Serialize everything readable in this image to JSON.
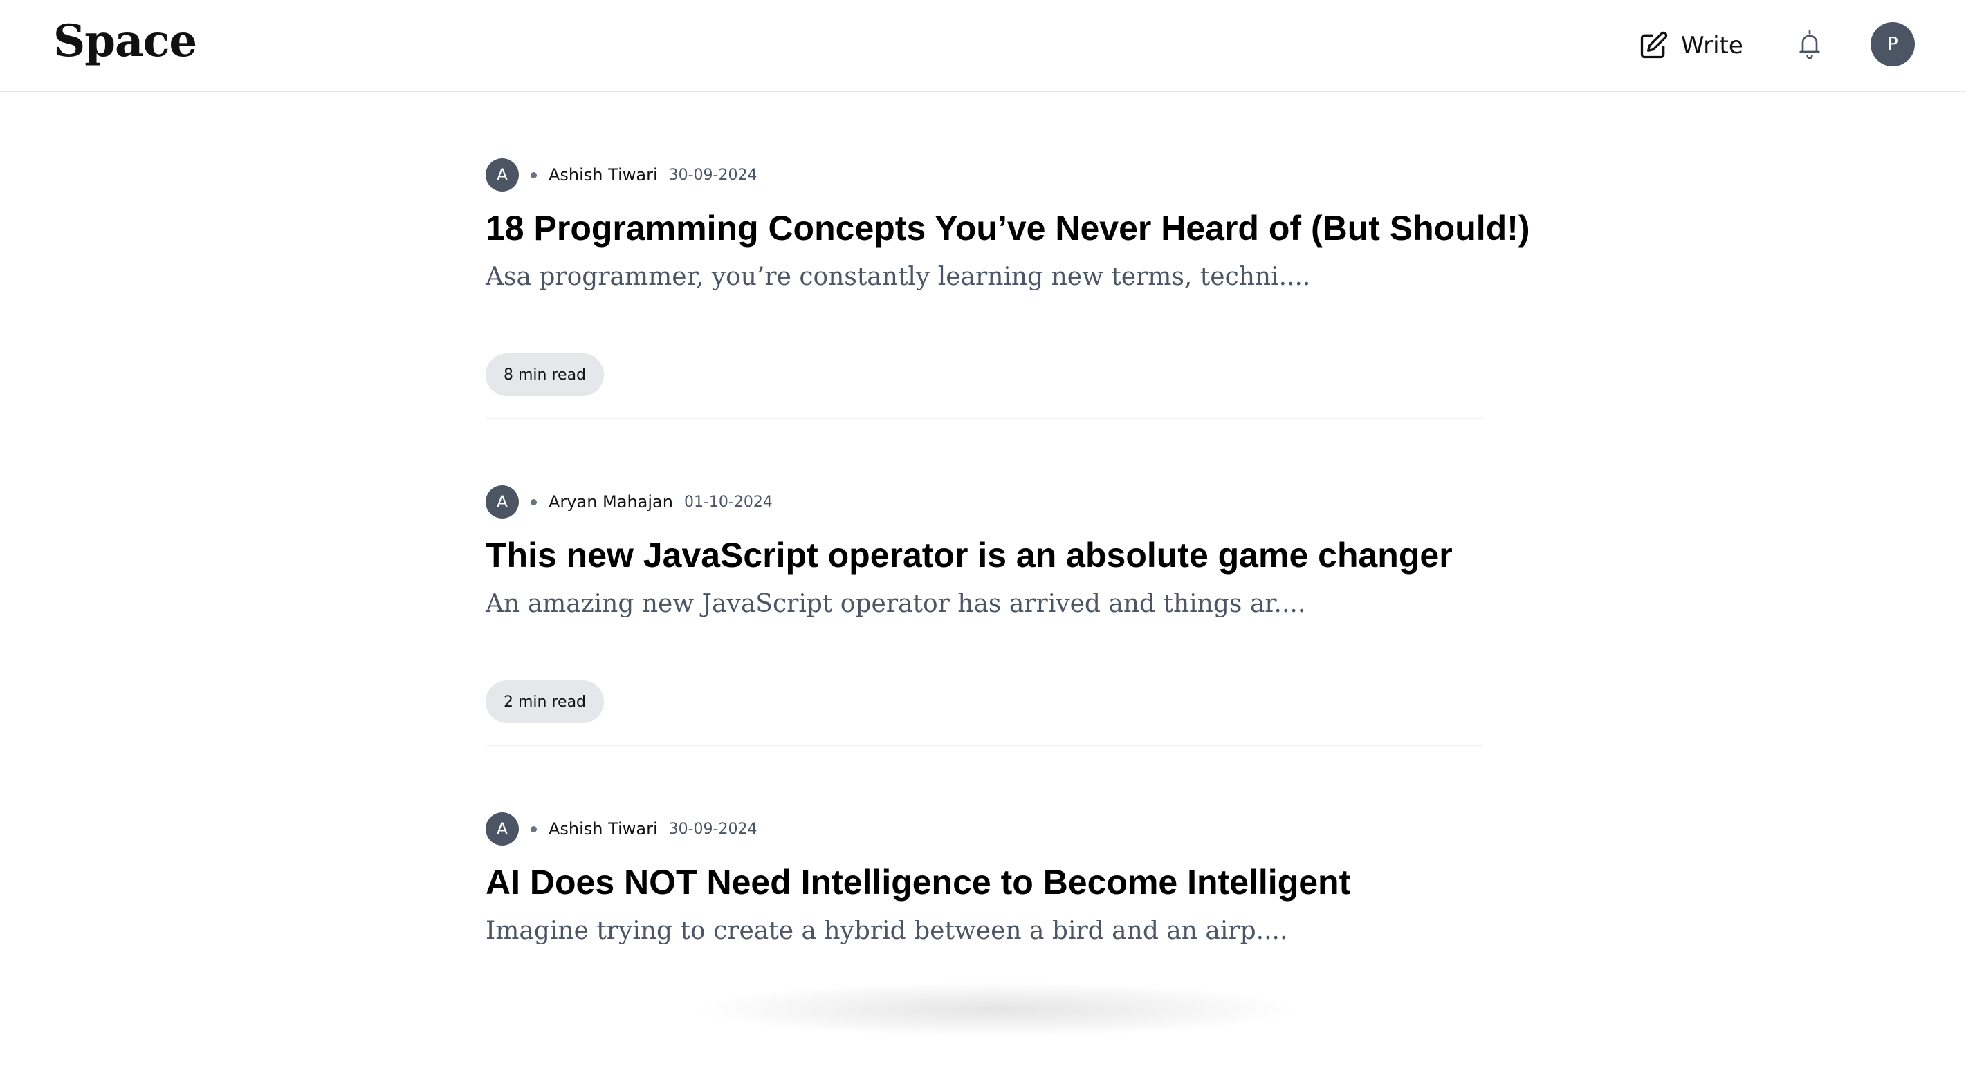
{
  "header": {
    "logo": "Space",
    "write_label": "Write",
    "profile_initial": "P"
  },
  "articles": [
    {
      "author_initial": "A",
      "author": "Ashish Tiwari",
      "date": "30-09-2024",
      "title": "18 Programming Concepts You’ve Never Heard of (But Should!)",
      "excerpt": "Asa programmer, you’re constantly learning new terms, techni....",
      "read_time": "8 min read"
    },
    {
      "author_initial": "A",
      "author": "Aryan Mahajan",
      "date": "01-10-2024",
      "title": "This new JavaScript operator is an absolute game changer",
      "excerpt": "An amazing new JavaScript operator has arrived and things ar....",
      "read_time": "2 min read"
    },
    {
      "author_initial": "A",
      "author": "Ashish Tiwari",
      "date": "30-09-2024",
      "title": "AI Does NOT Need Intelligence to Become Intelligent",
      "excerpt": "Imagine trying to create a hybrid between a bird and an airp...."
    }
  ],
  "colors": {
    "avatar_bg": "#4b5563",
    "read_time_bg": "#e5e7eb",
    "divider": "#eef0f2"
  },
  "icons": {
    "write": "pencil-square-icon",
    "notifications": "bell-icon"
  }
}
